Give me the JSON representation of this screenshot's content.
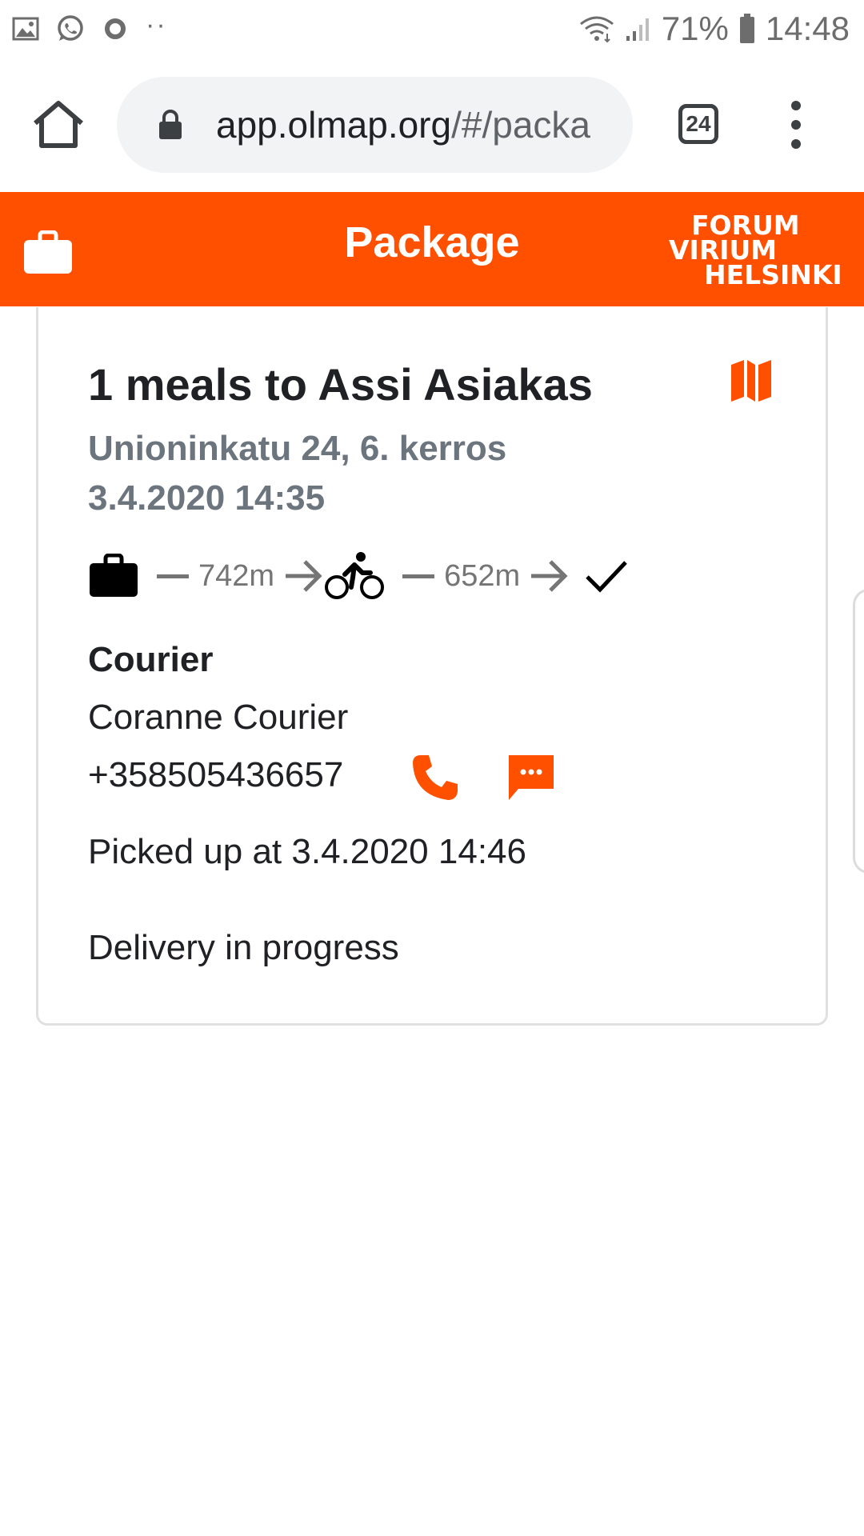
{
  "status_bar": {
    "battery_percent": "71%",
    "time": "14:48",
    "left_icons": [
      "image-icon",
      "whatsapp-icon",
      "circle-icon"
    ],
    "more_notifications": "··"
  },
  "browser": {
    "url_host": "app.olmap.org",
    "url_path": "/#/packa",
    "tab_count": "24"
  },
  "header": {
    "title": "Package",
    "brand_line1": "FORUM",
    "brand_line2": "VIRIUM",
    "brand_line3": "HELSINKI"
  },
  "package": {
    "title": "1 meals to Assi Asiakas",
    "address": "Unioninkatu 24, 6. kerros",
    "time": "3.4.2020 14:35",
    "route": {
      "distance_to_pickup": "742m",
      "distance_to_delivery": "652m"
    }
  },
  "courier": {
    "heading": "Courier",
    "name": "Coranne Courier",
    "phone": "+358505436657"
  },
  "pickup": "Picked up at 3.4.2020 14:46",
  "delivery_status": "Delivery in progress",
  "colors": {
    "accent": "#ff5000",
    "muted_text": "#6c757d",
    "text": "#202124"
  }
}
